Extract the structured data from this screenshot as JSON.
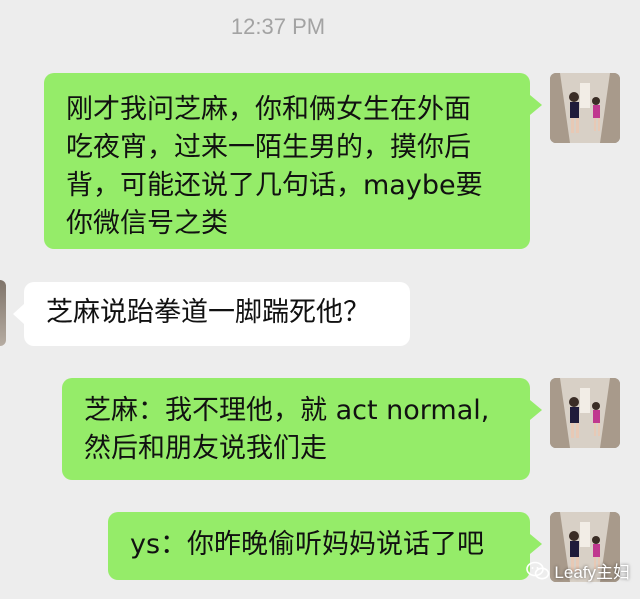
{
  "header": {
    "timestamp": "12:37 PM"
  },
  "messages": [
    {
      "side": "sent",
      "lines": [
        "刚才我问芝麻，你和俩女生在外面",
        "吃夜宵，过来一陌生男的，摸你后",
        "背，可能还说了几句话，maybe要",
        "你微信号之类"
      ]
    },
    {
      "side": "received",
      "lines": [
        "芝麻说跆拳道一脚踹死他？"
      ]
    },
    {
      "side": "sent",
      "lines": [
        "芝麻：我不理他，就 act normal,",
        "然后和朋友说我们走"
      ]
    },
    {
      "side": "sent",
      "lines": [
        "ys：你昨晚偷听妈妈说话了吧"
      ]
    }
  ],
  "watermark": {
    "text": "Leafy主妇",
    "icon": "wechat-icon"
  },
  "colors": {
    "background": "#ededed",
    "sent_bubble": "#95ec69",
    "received_bubble": "#ffffff",
    "timestamp": "#a3a3a3"
  }
}
